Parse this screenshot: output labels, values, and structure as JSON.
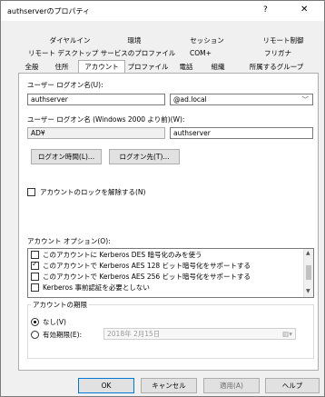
{
  "window": {
    "title": "authserverのプロパティ",
    "help": "?",
    "close": "✕"
  },
  "tabs": {
    "row1": [
      "ダイヤルイン",
      "環境",
      "セッション",
      "リモート制御"
    ],
    "row2": [
      "リモート デスクトップ サービスのプロファイル",
      "COM+",
      "フリガナ"
    ],
    "row3": [
      "全般",
      "住所",
      "アカウント",
      "プロファイル",
      "電話",
      "組織",
      "所属するグループ"
    ],
    "active": "アカウント"
  },
  "account": {
    "logon_name_label": "ユーザー ログオン名(U):",
    "logon_name_value": "authserver",
    "domain_value": "@ad.local",
    "pre2000_label": "ユーザー ログオン名 (Windows 2000 より前)(W):",
    "pre2000_domain": "AD¥",
    "pre2000_user": "authserver",
    "logon_hours_button": "ログオン時間(L)...",
    "logon_to_button": "ログオン先(T)...",
    "unlock_label": "アカウントのロックを解除する(N)",
    "options_label": "アカウント オプション(O):",
    "options": [
      {
        "label": "このアカウントに Kerberos DES 暗号化のみを使う",
        "checked": false
      },
      {
        "label": "このアカウントで Kerberos AES 128 ビット暗号化をサポートする",
        "checked": true
      },
      {
        "label": "このアカウントで Kerberos AES 256 ビット暗号化をサポートする",
        "checked": false
      },
      {
        "label": "Kerberos 事前認証を必要としない",
        "checked": false
      }
    ],
    "expiry_group_label": "アカウントの期限",
    "never_label": "なし(V)",
    "end_of_label": "有効期限(E):",
    "end_date": "2018年  2月15日"
  },
  "footer": {
    "ok": "OK",
    "cancel": "キャンセル",
    "apply": "適用(A)",
    "help": "ヘルプ"
  }
}
